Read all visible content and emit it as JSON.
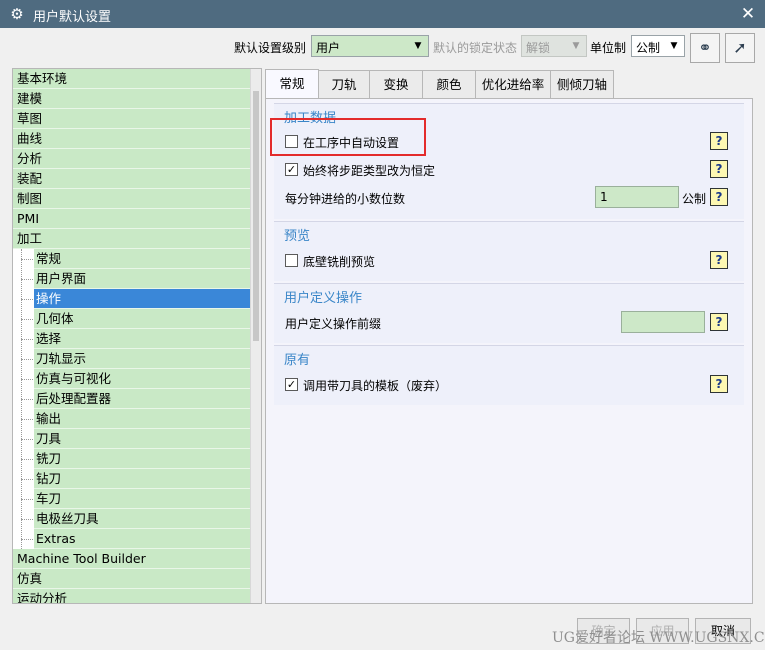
{
  "window": {
    "title": "用户默认设置"
  },
  "toolbar": {
    "level_label": "默认设置级别",
    "level_value": "用户",
    "lock_label": "默认的锁定状态",
    "lock_value": "解锁",
    "unit_label": "单位制",
    "unit_value": "公制"
  },
  "tree": {
    "top_items": [
      "基本环境",
      "建模",
      "草图",
      "曲线",
      "分析",
      "装配",
      "制图",
      "PMI",
      "加工"
    ],
    "children": [
      "常规",
      "用户界面",
      "操作",
      "几何体",
      "选择",
      "刀轨显示",
      "仿真与可视化",
      "后处理配置器",
      "输出",
      "刀具",
      "铣刀",
      "钻刀",
      "车刀",
      "电极丝刀具",
      "Extras"
    ],
    "selected_child": "操作",
    "bottom_items": [
      "Machine Tool Builder",
      "仿真",
      "运动分析"
    ]
  },
  "tabs": [
    "常规",
    "刀轨",
    "变换",
    "颜色",
    "优化进给率",
    "侧倾刀轴"
  ],
  "active_tab": "常规",
  "groups": {
    "processing": {
      "title": "加工数据",
      "auto_setup": {
        "label": "在工序中自动设置",
        "checked": false
      },
      "always_constant": {
        "label": "始终将步距类型改为恒定",
        "checked": true
      },
      "decimal_places": {
        "label": "每分钟进给的小数位数",
        "value": "1",
        "unit": "公制"
      }
    },
    "preview": {
      "title": "预览",
      "floor_wall": {
        "label": "底壁铣削预览",
        "checked": false
      }
    },
    "user_ops": {
      "title": "用户定义操作",
      "prefix": {
        "label": "用户定义操作前缀",
        "value": ""
      }
    },
    "legacy": {
      "title": "原有",
      "template": {
        "label": "调用带刀具的模板（废弃）",
        "checked": true
      }
    }
  },
  "help_symbol": "?",
  "footer": {
    "ok": "确定",
    "apply": "应用",
    "cancel": "取消"
  },
  "watermark": "UG爱好者论坛 WWW.UGSNX.COM",
  "colors": {
    "titlebar": "#4f6b80",
    "tree_item": "#c9e9c6",
    "selected": "#3a87d8",
    "group_title": "#3a86c8",
    "highlight": "#e32b2b"
  }
}
